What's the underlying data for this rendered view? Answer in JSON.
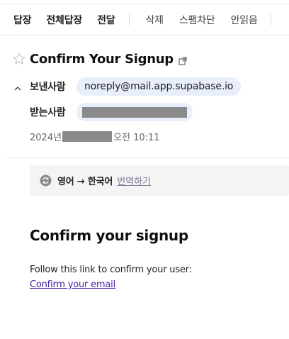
{
  "toolbar": {
    "reply": "답장",
    "reply_all": "전체답장",
    "forward": "전달",
    "delete": "삭제",
    "block_spam": "스팸차단",
    "mark_unread": "안읽음"
  },
  "email": {
    "subject": "Confirm Your Signup",
    "from_label": "보낸사람",
    "from_address": "noreply@mail.app.supabase.io",
    "to_label": "받는사람",
    "date_prefix": "2024년",
    "time": "오전 10:11"
  },
  "translate": {
    "language_pair": "영어 → 한국어",
    "link_label": "번역하기"
  },
  "body": {
    "heading": "Confirm your signup",
    "text": "Follow this link to confirm your user:",
    "link_text": "Confirm your email"
  },
  "colors": {
    "pill_bg": "#e8eefc",
    "redaction": "#8a8a8a",
    "link": "#4b1fa8"
  },
  "icons": {
    "star": "star-outline-icon",
    "popout": "external-link-icon",
    "caret": "chevron-up-icon",
    "translate": "translate-icon"
  }
}
